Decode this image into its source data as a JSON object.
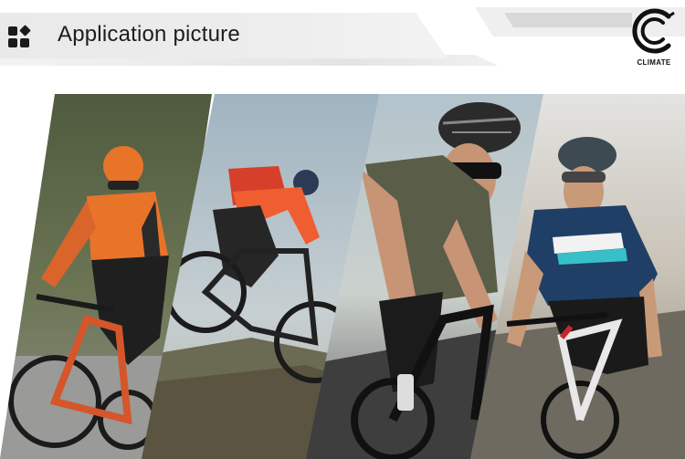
{
  "header": {
    "title": "Application picture",
    "icon": "grid-diamond-icon"
  },
  "logo": {
    "text": "CLIMATE",
    "icon": "c-logo-icon"
  },
  "photos": [
    {
      "name": "cyclist-orange-jersey-photo"
    },
    {
      "name": "cyclist-red-backpack-mtb-photo"
    },
    {
      "name": "cyclist-olive-jersey-photo"
    },
    {
      "name": "cyclist-blue-jersey-photo"
    }
  ],
  "colors": {
    "header_band": "#ececec",
    "title_text": "#1d1d1d",
    "panel1_accent": "#e8742a",
    "panel2_accent": "#e8502a",
    "panel3_accent": "#5c5f4a",
    "panel4_accent": "#1f3f66"
  }
}
